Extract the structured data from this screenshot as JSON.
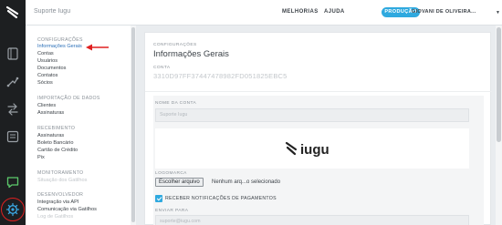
{
  "colors": {
    "accent": "#2fa9df",
    "rail": "#1d1f21",
    "active_link": "#2a6fb8",
    "highlight": "#e02020"
  },
  "rail": {
    "icons": [
      "iugu-logo-icon",
      "invoice-icon",
      "transfer-icon",
      "exchange-icon",
      "report-icon",
      "chat-icon",
      "gear-icon"
    ]
  },
  "topbar": {
    "account_name": "Suporte Iugu",
    "nav": [
      "MELHORIAS",
      "AJUDA"
    ],
    "environment_label": "PRODUÇÃO",
    "user_name": "GIOVANI DE OLIVEIRA..."
  },
  "menu": {
    "groups": [
      {
        "title": "CONFIGURAÇÕES",
        "items": [
          "Informações Gerais",
          "Contas",
          "Usuários",
          "Documentos",
          "Contatos",
          "Sócios"
        ]
      },
      {
        "title": "IMPORTAÇÃO DE DADOS",
        "items": [
          "Clientes",
          "Assinaturas"
        ]
      },
      {
        "title": "RECEBIMENTO",
        "items": [
          "Assinaturas",
          "Boleto Bancário",
          "Cartão de Crédito",
          "Pix"
        ]
      },
      {
        "title": "MONITORAMENTO",
        "items": [
          "Situação dos Gatilhos"
        ]
      },
      {
        "title": "DESENVOLVEDOR",
        "items": [
          "Integração via API",
          "Comunicação via Gatilhos",
          "Log de Gatilhos"
        ]
      }
    ]
  },
  "content": {
    "breadcrumb": "CONFIGURAÇÕES",
    "title": "Informações Gerais",
    "account_label": "CONTA",
    "account_id": "3310D97FF37447478982FD051825EBC5",
    "account_name_label": "NOME DA CONTA",
    "account_name_value": "Suporte Iugu",
    "logo_label": "LOGOMARCA",
    "logo_text": "iugu",
    "file_button": "Escolher arquivo",
    "file_status": "Nenhum arq...o selecionado",
    "notifications_label": "RECEBER NOTIFICAÇÕES DE PAGAMENTOS",
    "notifications_checked": true,
    "send_to_label": "ENVIAR PARA",
    "send_to_value": "suporte@iugu.com"
  }
}
